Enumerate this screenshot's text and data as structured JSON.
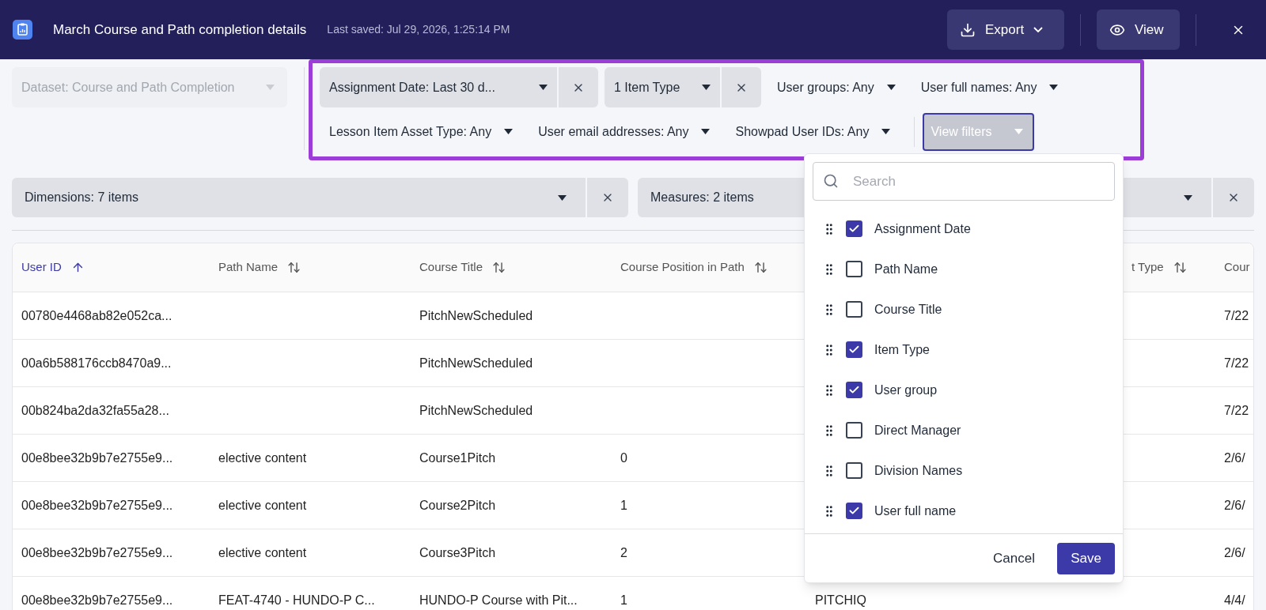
{
  "header": {
    "title": "March Course and Path completion details",
    "last_saved": "Last saved: Jul 29, 2026, 1:25:14 PM",
    "buttons": [
      {
        "kind": "export",
        "label": "Export"
      },
      {
        "kind": "view",
        "label": "View"
      }
    ]
  },
  "dataset": {
    "label": "Dataset: Course and Path Completion",
    "disabled": true
  },
  "filters": [
    {
      "label": "Assignment Date: Last 30 d...",
      "active": true
    },
    {
      "label": "1 Item Type",
      "active": true
    },
    {
      "label": "User groups: Any",
      "active": false
    },
    {
      "label": "User full names: Any",
      "active": false
    },
    {
      "label": "Lesson Item Asset Type: Any",
      "active": false
    },
    {
      "label": "User email addresses: Any",
      "active": false
    },
    {
      "label": "Showpad User IDs: Any",
      "active": false
    }
  ],
  "view_filters_button": {
    "label": "View filters"
  },
  "fields": [
    {
      "label": "Dimensions: 7 items"
    },
    {
      "label": "Measures: 2 items"
    }
  ],
  "table": {
    "columns": [
      {
        "label": "User ID",
        "sortable": true,
        "sorted": true
      },
      {
        "label": "Path Name",
        "sortable": true,
        "sorted": false
      },
      {
        "label": "Course Title",
        "sortable": true,
        "sorted": false
      },
      {
        "label": "Course Position in Path",
        "sortable": true,
        "sorted": false
      },
      null,
      {
        "label": "t Type",
        "sortable": true,
        "sorted": false
      },
      {
        "label": "Cour",
        "sortable": false,
        "sorted": false
      }
    ],
    "rows": [
      [
        "00780e4468ab82e052ca...",
        null,
        "PitchNewScheduled",
        null,
        null,
        null,
        "7/22"
      ],
      [
        "00a6b588176ccb8470a9...",
        null,
        "PitchNewScheduled",
        null,
        null,
        null,
        "7/22"
      ],
      [
        "00b824ba2da32fa55a28...",
        null,
        "PitchNewScheduled",
        null,
        null,
        null,
        "7/22"
      ],
      [
        "00e8bee32b9b7e2755e9...",
        "elective content",
        "Course1Pitch",
        "0",
        null,
        null,
        "2/6/"
      ],
      [
        "00e8bee32b9b7e2755e9...",
        "elective content",
        "Course2Pitch",
        "1",
        null,
        null,
        "2/6/"
      ],
      [
        "00e8bee32b9b7e2755e9...",
        "elective content",
        "Course3Pitch",
        "2",
        null,
        null,
        "2/6/"
      ],
      [
        "00e8bee32b9b7e2755e9...",
        "FEAT-4740 - HUNDO-P C...",
        "HUNDO-P Course with Pit...",
        "1",
        "PITCHIQ",
        null,
        "4/4/"
      ]
    ]
  },
  "filter_menu": {
    "search_placeholder": "Search",
    "items": [
      {
        "label": "Assignment Date",
        "checked": true
      },
      {
        "label": "Path Name",
        "checked": false
      },
      {
        "label": "Course Title",
        "checked": false
      },
      {
        "label": "Item Type",
        "checked": true
      },
      {
        "label": "User group",
        "checked": true
      },
      {
        "label": "Direct Manager",
        "checked": false
      },
      {
        "label": "Division Names",
        "checked": false
      },
      {
        "label": "User full name",
        "checked": true
      }
    ],
    "cancel": "Cancel",
    "save": "Save"
  }
}
